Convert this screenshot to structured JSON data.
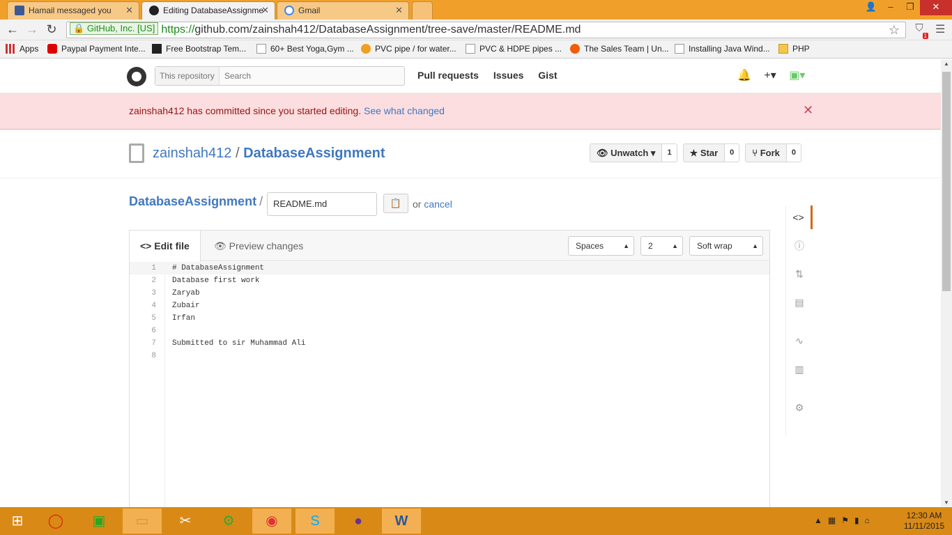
{
  "browser": {
    "tabs": [
      {
        "title": "Hamail messaged you",
        "icon": "facebook-icon"
      },
      {
        "title": "Editing DatabaseAssignme",
        "icon": "github-icon"
      },
      {
        "title": "Gmail",
        "icon": "google-icon"
      }
    ],
    "url": {
      "ev_label": "GitHub, Inc. [US]",
      "scheme": "https://",
      "rest": "github.com/zainshah412/DatabaseAssignment/tree-save/master/README.md"
    },
    "bookmarks": [
      {
        "label": "Apps"
      },
      {
        "label": "Paypal Payment Inte..."
      },
      {
        "label": "Free Bootstrap Tem..."
      },
      {
        "label": "60+ Best Yoga,Gym ..."
      },
      {
        "label": "PVC pipe / for water..."
      },
      {
        "label": "PVC & HDPE pipes ..."
      },
      {
        "label": "The Sales Team | Un..."
      },
      {
        "label": "Installing Java Wind..."
      },
      {
        "label": "PHP"
      }
    ]
  },
  "header": {
    "search_scope": "This repository",
    "search_placeholder": "Search",
    "links": [
      "Pull requests",
      "Issues",
      "Gist"
    ]
  },
  "flash": {
    "message": "zainshah412 has committed since you started editing.",
    "link": "See what changed"
  },
  "repo": {
    "owner": "zainshah412",
    "separator": "/",
    "name": "DatabaseAssignment",
    "unwatch_label": "Unwatch",
    "unwatch_count": "1",
    "star_label": "Star",
    "star_count": "0",
    "fork_label": "Fork",
    "fork_count": "0"
  },
  "edit": {
    "breadcrumb_repo": "DatabaseAssignment",
    "breadcrumb_sep": "/",
    "filename": "README.md",
    "or": "or",
    "cancel": "cancel",
    "tab_edit": "Edit file",
    "tab_preview": "Preview changes",
    "indent_mode": "Spaces",
    "indent_size": "2",
    "wrap_mode": "Soft wrap"
  },
  "code_lines": [
    "# DatabaseAssignment",
    "Database first work",
    "Zaryab",
    "Zubair",
    "Irfan",
    "",
    "Submitted to sir Muhammad Ali",
    ""
  ],
  "line_numbers": [
    "1",
    "2",
    "3",
    "4",
    "5",
    "6",
    "7",
    "8"
  ],
  "taskbar": {
    "time": "12:30 AM",
    "date": "11/11/2015"
  }
}
